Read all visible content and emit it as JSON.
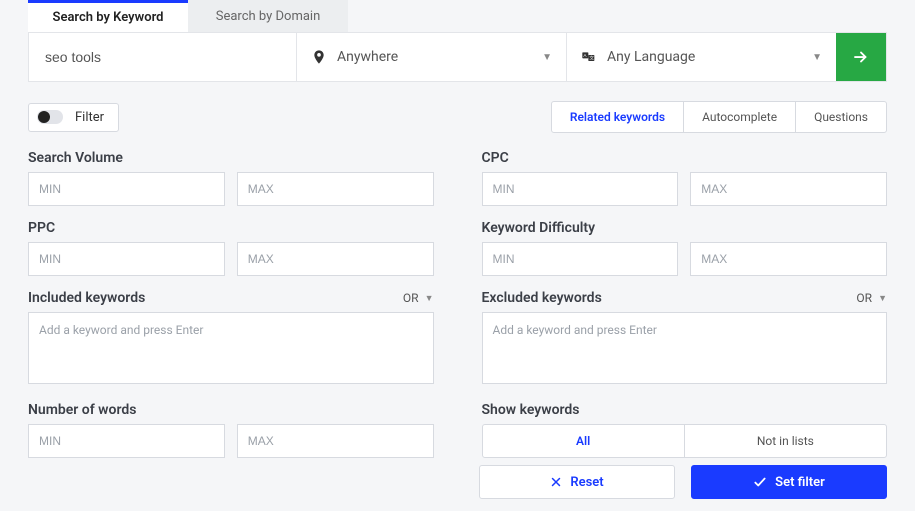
{
  "tabs": {
    "keyword": "Search by Keyword",
    "domain": "Search by Domain"
  },
  "search": {
    "keyword_value": "seo tools",
    "location_label": "Anywhere",
    "language_label": "Any Language"
  },
  "filter_toggle_label": "Filter",
  "keyword_tabs": {
    "related": "Related keywords",
    "autocomplete": "Autocomplete",
    "questions": "Questions"
  },
  "labels": {
    "search_volume": "Search Volume",
    "cpc": "CPC",
    "ppc": "PPC",
    "kd": "Keyword Difficulty",
    "included": "Included keywords",
    "excluded": "Excluded keywords",
    "num_words": "Number of words",
    "show_kw": "Show keywords"
  },
  "placeholders": {
    "min": "MIN",
    "max": "MAX",
    "add_kw": "Add a keyword and press Enter"
  },
  "logic": {
    "or": "OR"
  },
  "segmented": {
    "all": "All",
    "not_in_lists": "Not in lists"
  },
  "buttons": {
    "reset": "Reset",
    "set_filter": "Set filter"
  }
}
